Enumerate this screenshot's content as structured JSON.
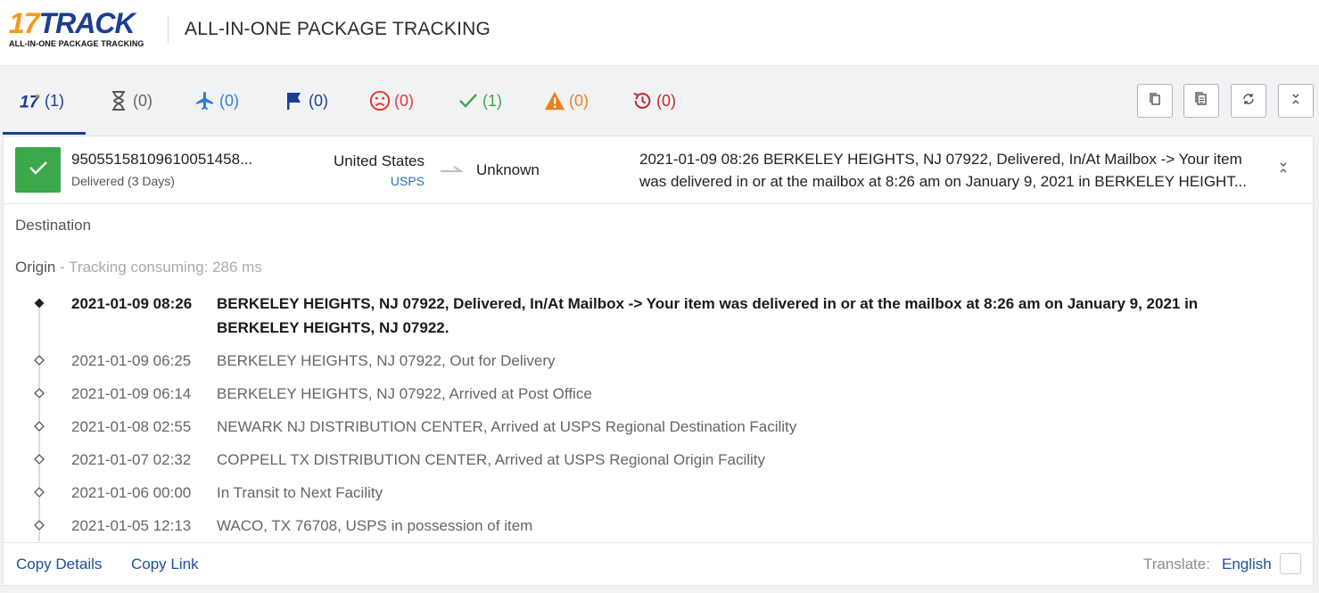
{
  "header": {
    "logo_main_17": "17",
    "logo_main_track": "TRACK",
    "logo_sub": "ALL-IN-ONE PACKAGE TRACKING",
    "title": "ALL-IN-ONE PACKAGE TRACKING"
  },
  "tabs": [
    {
      "name": "all",
      "icon": "17track-logo-icon",
      "count": "(1)",
      "color": "#1a3f8f"
    },
    {
      "name": "not-found",
      "icon": "hourglass-icon",
      "count": "(0)",
      "color": "#666666"
    },
    {
      "name": "in-transit",
      "icon": "airplane-icon",
      "count": "(0)",
      "color": "#2f7fd6"
    },
    {
      "name": "pick-up",
      "icon": "flag-icon",
      "count": "(0)",
      "color": "#1a3f8f"
    },
    {
      "name": "undelivered",
      "icon": "sad-face-icon",
      "count": "(0)",
      "color": "#e53935"
    },
    {
      "name": "delivered",
      "icon": "checkmark-icon",
      "count": "(1)",
      "color": "#3aa84b"
    },
    {
      "name": "alert",
      "icon": "warning-icon",
      "count": "(0)",
      "color": "#f07d1b"
    },
    {
      "name": "expired",
      "icon": "history-icon",
      "count": "(0)",
      "color": "#c62828"
    }
  ],
  "actions": [
    {
      "name": "copy",
      "icon": "copy-icon"
    },
    {
      "name": "copy-details",
      "icon": "document-icon"
    },
    {
      "name": "refresh",
      "icon": "refresh-icon"
    },
    {
      "name": "collapse-all",
      "icon": "collapse-icon"
    }
  ],
  "shipment": {
    "tracking_number": "9505515810961005145​8...",
    "status_text": "Delivered (3 Days)",
    "status_color": "#3aa84b",
    "origin_country": "United States",
    "carrier": "USPS",
    "destination_country": "Unknown",
    "latest_event_line1": "2021-01-09 08:26  BERKELEY HEIGHTS, NJ 07922, Delivered, In/At Mailbox -> Your item",
    "latest_event_line2": "was delivered in or at the mailbox at 8:26 am on January 9, 2021 in BERKELEY HEIGHT..."
  },
  "details": {
    "destination_label": "Destination",
    "origin_label": "Origin",
    "origin_meta": " - Tracking consuming: 286 ms"
  },
  "events": [
    {
      "time": "2021-01-09 08:26",
      "desc": "BERKELEY HEIGHTS, NJ 07922, Delivered, In/At Mailbox -> Your item was delivered in or at the mailbox at 8:26 am on January 9, 2021 in BERKELEY HEIGHTS, NJ 07922."
    },
    {
      "time": "2021-01-09 06:25",
      "desc": "BERKELEY HEIGHTS, NJ 07922, Out for Delivery"
    },
    {
      "time": "2021-01-09 06:14",
      "desc": "BERKELEY HEIGHTS, NJ 07922, Arrived at Post Office"
    },
    {
      "time": "2021-01-08 02:55",
      "desc": "NEWARK NJ DISTRIBUTION CENTER, Arrived at USPS Regional Destination Facility"
    },
    {
      "time": "2021-01-07 02:32",
      "desc": "COPPELL TX DISTRIBUTION CENTER, Arrived at USPS Regional Origin Facility"
    },
    {
      "time": "2021-01-06 00:00",
      "desc": "In Transit to Next Facility"
    },
    {
      "time": "2021-01-05 12:13",
      "desc": "WACO, TX 76708, USPS in possession of item"
    }
  ],
  "footer": {
    "copy_details": "Copy Details",
    "copy_link": "Copy Link",
    "translate_label": "Translate:",
    "translate_lang": "English"
  }
}
